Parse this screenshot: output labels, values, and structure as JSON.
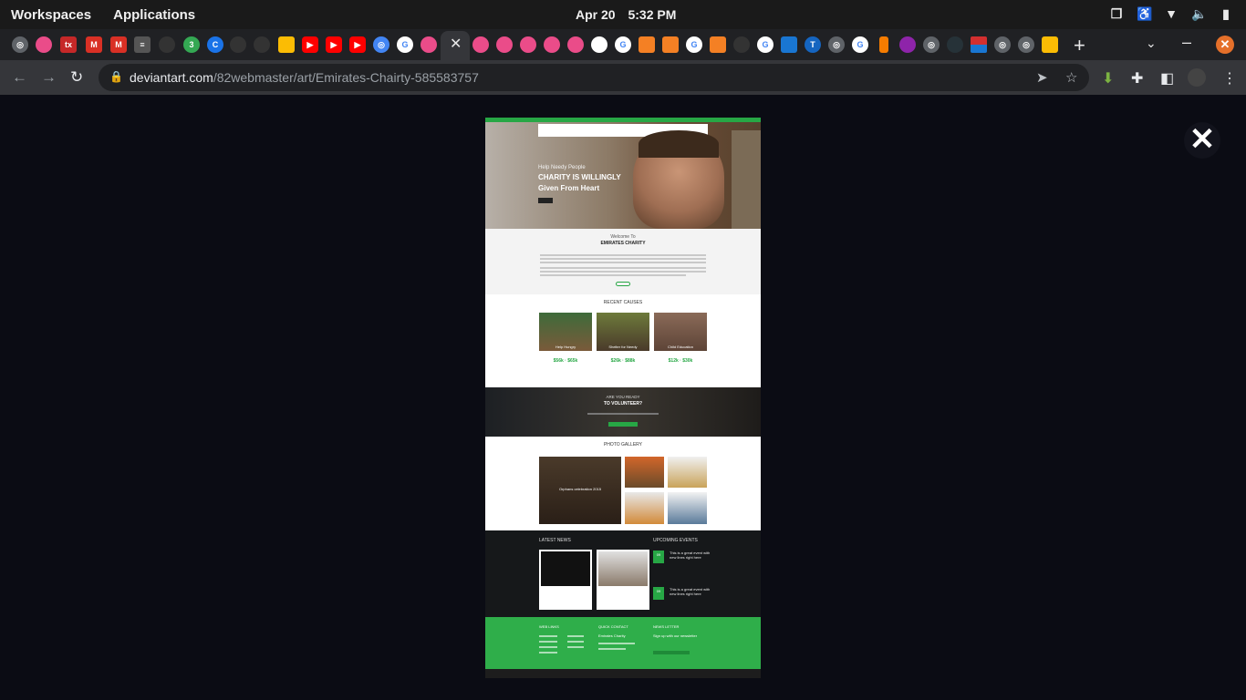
{
  "system_bar": {
    "workspaces_label": "Workspaces",
    "applications_label": "Applications",
    "date": "Apr 20",
    "time": "5:32 PM"
  },
  "browser": {
    "url_host": "deviantart.com",
    "url_path": "/82webmaster/art/Emirates-Chairty-585583757",
    "tab_count_visible": 44,
    "active_tab_close": "✕"
  },
  "artwork": {
    "hero_subtitle": "Help Needy People",
    "hero_line1": "CHARITY IS WILLINGLY",
    "hero_line2": "Given From Heart",
    "welcome_intro": "Welcome To",
    "welcome_title": "EMIRATES CHARITY",
    "causes_title": "RECENT CAUSES",
    "causes": [
      {
        "label": "Help Hungry",
        "raised": "$56k",
        "goal": "$65k"
      },
      {
        "label": "Shelter for Needy",
        "raised": "$26k",
        "goal": "$88k"
      },
      {
        "label": "Child Education",
        "raised": "$12k",
        "goal": "$30k"
      }
    ],
    "volunteer_line1": "ARE YOU READY",
    "volunteer_line2": "TO VOLUNTEER?",
    "gallery_title": "PHOTO GALLERY",
    "gallery_caption": "Orphans celebration 2015",
    "news_title": "LATEST NEWS",
    "events_title": "UPCOMING EVENTS",
    "events": [
      {
        "date": "09",
        "text": "This is a great event with new lines right here"
      },
      {
        "date": "09",
        "text": "This is a great event with new lines right here"
      }
    ],
    "footer_links_title": "WEB LINKS",
    "footer_contact_title": "QUICK CONTACT",
    "footer_contact_name": "Emirates Charity",
    "footer_newsletter_title": "NEWS LETTER",
    "footer_newsletter_sub": "Sign up with our newsletter"
  }
}
